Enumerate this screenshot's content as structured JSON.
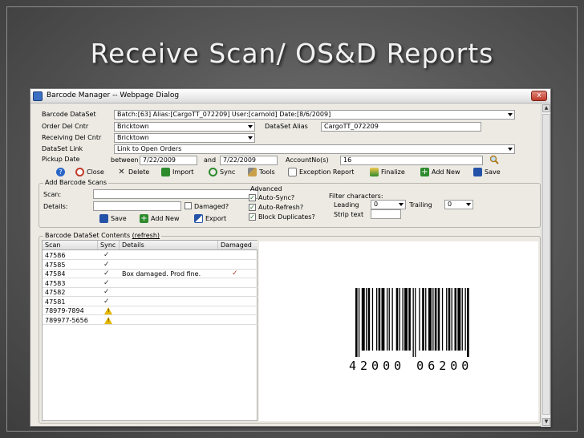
{
  "slide": {
    "title": "Receive Scan/ OS&D Reports"
  },
  "dialog": {
    "title": "Barcode Manager -- Webpage Dialog",
    "close_glyph": "x",
    "scroll_up": "▲",
    "scroll_down": "▼"
  },
  "form": {
    "barcode_dataset_label": "Barcode DataSet",
    "barcode_dataset_value": "Batch:[63] Alias:[CargoTT_072209] User:[carnold] Date:[8/6/2009]",
    "order_del_cntr_label": "Order Del Cntr",
    "order_del_cntr_value": "Bricktown",
    "dataset_alias_label": "DataSet Alias",
    "dataset_alias_value": "CargoTT_072209",
    "receiving_del_cntr_label": "Receiving Del Cntr",
    "receiving_del_cntr_value": "Bricktown",
    "dataset_link_label": "DataSet Link",
    "dataset_link_value": "Link to Open Orders",
    "pickup_date_label": "Pickup Date",
    "between_label": "between",
    "date_from": "7/22/2009",
    "and_label": "and",
    "date_to": "7/22/2009",
    "account_label": "AccountNo(s)",
    "account_value": "16"
  },
  "toolbar": {
    "help": "",
    "close": "Close",
    "delete": "Delete",
    "import": "Import",
    "sync": "Sync",
    "tools": "Tools",
    "exception_report": "Exception Report",
    "finalize": "Finalize",
    "add_new": "Add New",
    "save": "Save"
  },
  "add_scans": {
    "title": "Add Barcode Scans",
    "scan_label": "Scan:",
    "scan_value": "",
    "details_label": "Details:",
    "details_value": "",
    "damaged_label": "Damaged?",
    "save": "Save",
    "add_new": "Add New",
    "export": "Export",
    "advanced_label": "Advanced",
    "auto_sync": "Auto-Sync?",
    "auto_refresh": "Auto-Refresh?",
    "block_duplicates": "Block Duplicates?",
    "filter_label": "Filter characters:",
    "leading_label": "Leading",
    "leading_value": "0",
    "trailing_label": "Trailing",
    "trailing_value": "0",
    "strip_text_label": "Strip text",
    "strip_text_value": ""
  },
  "contents": {
    "title": "Barcode DataSet Contents",
    "refresh": "(refresh)",
    "columns": [
      "Scan",
      "Sync",
      "Details",
      "Damaged"
    ],
    "rows": [
      {
        "scan": "47586",
        "sync": "check",
        "details": "",
        "damaged": ""
      },
      {
        "scan": "47585",
        "sync": "check",
        "details": "",
        "damaged": ""
      },
      {
        "scan": "47584",
        "sync": "check",
        "details": "Box damaged. Prod fine.",
        "damaged": "check"
      },
      {
        "scan": "47583",
        "sync": "check",
        "details": "",
        "damaged": ""
      },
      {
        "scan": "47582",
        "sync": "check",
        "details": "",
        "damaged": ""
      },
      {
        "scan": "47581",
        "sync": "check",
        "details": "",
        "damaged": ""
      },
      {
        "scan": "78979-7894",
        "sync": "warning",
        "details": "",
        "damaged": ""
      },
      {
        "scan": "789977-5656",
        "sync": "warning",
        "details": "",
        "damaged": ""
      }
    ]
  },
  "barcode": {
    "digits": "42000 06200"
  },
  "icons": {
    "check": "✓",
    "warning": "!",
    "help_color": "#2a66c9",
    "close_color": "#c23b2a",
    "import_color": "#2e8b2e",
    "save_color": "#2452a8"
  }
}
